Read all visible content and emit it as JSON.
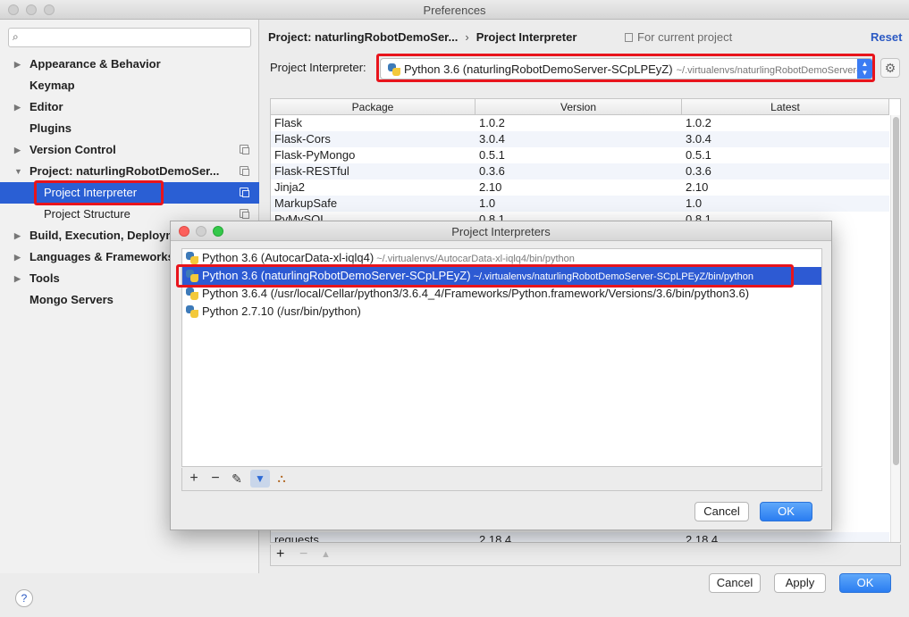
{
  "window": {
    "title": "Preferences"
  },
  "sidebar": {
    "search_placeholder": "",
    "search_icon": "⌕",
    "items": [
      {
        "label": "Appearance & Behavior",
        "arrow": "▶"
      },
      {
        "label": "Keymap"
      },
      {
        "label": "Editor",
        "arrow": "▶"
      },
      {
        "label": "Plugins"
      },
      {
        "label": "Version Control",
        "arrow": "▶"
      },
      {
        "label": "Project: naturlingRobotDemoSer...",
        "arrow": "▼"
      },
      {
        "label": "Project Interpreter"
      },
      {
        "label": "Project Structure"
      },
      {
        "label": "Build, Execution, Deployment",
        "arrow": "▶"
      },
      {
        "label": "Languages & Frameworks",
        "arrow": "▶"
      },
      {
        "label": "Tools",
        "arrow": "▶"
      },
      {
        "label": "Mongo Servers"
      }
    ]
  },
  "header": {
    "breadcrumb_project": "Project: naturlingRobotDemoSer...",
    "breadcrumb_sep": "›",
    "breadcrumb_page": "Project Interpreter",
    "for_current": "For current project",
    "reset": "Reset"
  },
  "interpreter": {
    "label": "Project Interpreter:",
    "selected_name": "Python 3.6 (naturlingRobotDemoServer-SCpLPEyZ)",
    "selected_path": "~/.virtualenvs/naturlingRobotDemoServer-SCpLPEyZ/bin/python",
    "stepper_up": "▲",
    "stepper_down": "▼",
    "gear": "⚙"
  },
  "packages": {
    "headers": [
      "Package",
      "Version",
      "Latest"
    ],
    "rows": [
      [
        "Flask",
        "1.0.2",
        "1.0.2"
      ],
      [
        "Flask-Cors",
        "3.0.4",
        "3.0.4"
      ],
      [
        "Flask-PyMongo",
        "0.5.1",
        "0.5.1"
      ],
      [
        "Flask-RESTful",
        "0.3.6",
        "0.3.6"
      ],
      [
        "Jinja2",
        "2.10",
        "2.10"
      ],
      [
        "MarkupSafe",
        "1.0",
        "1.0"
      ],
      [
        "PyMySQL",
        "0.8.1",
        "0.8.1"
      ]
    ],
    "last_row": [
      "requests",
      "2.18.4",
      "2.18.4"
    ],
    "tools": {
      "add": "+",
      "remove": "−",
      "upgrade": "▲"
    }
  },
  "dialog": {
    "title": "Project Interpreters",
    "items": [
      {
        "name": "Python 3.6 (AutocarData-xl-iqlq4)",
        "path": "~/.virtualenvs/AutocarData-xl-iqlq4/bin/python"
      },
      {
        "name": "Python 3.6 (naturlingRobotDemoServer-SCpLPEyZ)",
        "path": "~/.virtualenvs/naturlingRobotDemoServer-SCpLPEyZ/bin/python"
      },
      {
        "name": "Python 3.6.4 (/usr/local/Cellar/python3/3.6.4_4/Frameworks/Python.framework/Versions/3.6/bin/python3.6)",
        "path": ""
      },
      {
        "name": "Python 2.7.10 (/usr/bin/python)",
        "path": ""
      }
    ],
    "tools": {
      "add": "+",
      "remove": "−",
      "edit": "✎",
      "filter": "▼",
      "tree": "⛬"
    },
    "cancel": "Cancel",
    "ok": "OK"
  },
  "footer": {
    "help": "?",
    "cancel": "Cancel",
    "apply": "Apply",
    "ok": "OK"
  },
  "colors": {
    "selection": "#2a5fd4",
    "highlight": "#e8141c",
    "primary_button": "#2a7df1"
  }
}
